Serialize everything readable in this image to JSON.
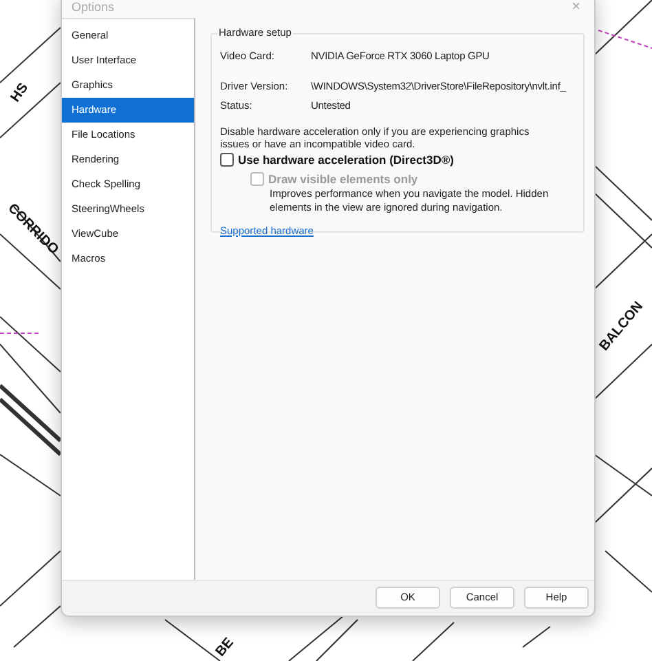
{
  "window": {
    "title": "Options",
    "close": "×"
  },
  "sidebar": {
    "items": [
      {
        "label": "General",
        "selected": false
      },
      {
        "label": "User Interface",
        "selected": false
      },
      {
        "label": "Graphics",
        "selected": false
      },
      {
        "label": "Hardware",
        "selected": true
      },
      {
        "label": "File Locations",
        "selected": false
      },
      {
        "label": "Rendering",
        "selected": false
      },
      {
        "label": "Check Spelling",
        "selected": false
      },
      {
        "label": "SteeringWheels",
        "selected": false
      },
      {
        "label": "ViewCube",
        "selected": false
      },
      {
        "label": "Macros",
        "selected": false
      }
    ]
  },
  "hardware_setup": {
    "title": "Hardware setup",
    "fields": [
      {
        "label": "Video Card:",
        "value": "NVIDIA GeForce RTX 3060 Laptop GPU"
      },
      {
        "label": "Driver Version:",
        "value": "\\WINDOWS\\System32\\DriverStore\\FileRepository\\nvlt.inf_"
      },
      {
        "label": "Status:",
        "value": "Untested"
      }
    ],
    "note": "Disable hardware acceleration only if you are experiencing graphics issues or have an incompatible video card.",
    "options": [
      {
        "label": "Use hardware acceleration (Direct3D®)",
        "checked": false,
        "disabled": false,
        "children": [
          {
            "label": "Draw visible elements only",
            "checked": false,
            "disabled": true,
            "description": "Improves performance when you navigate the model. Hidden elements in the view are ignored during navigation."
          }
        ]
      }
    ],
    "link": "Supported hardware"
  },
  "buttons": [
    "OK",
    "Cancel",
    "Help"
  ],
  "canvas": {
    "labels": [
      "HS",
      "CORRIDO",
      "BALCON",
      "BE"
    ]
  }
}
